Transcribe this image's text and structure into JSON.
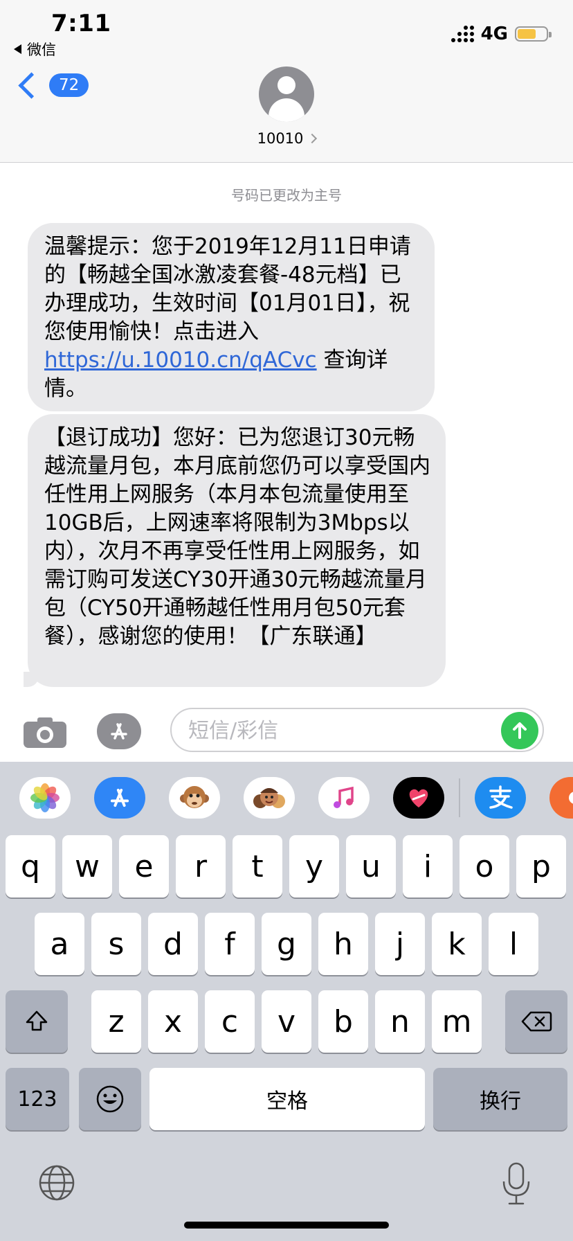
{
  "status_bar": {
    "time": "7:11",
    "back_app": "微信",
    "network": "4G",
    "battery_color": "#f6c344",
    "battery_level": 0.6
  },
  "header": {
    "unread_count": "72",
    "contact_name": "10010"
  },
  "conversation": {
    "system_note": "号码已更改为主号",
    "messages": [
      {
        "text_before_link": "温馨提示：您于2019年12月11日申请的【畅越全国冰激凌套餐-48元档】已办理成功，生效时间【01月01日】，祝您使用愉快！点击进入",
        "link": "https://u.10010.cn/qACvc",
        "text_after_link": " 查询详情。"
      },
      {
        "text": "【退订成功】您好：已为您退订30元畅越流量月包，本月底前您仍可以享受国内任性用上网服务（本月本包流量使用至10GB后，上网速率将限制为3Mbps以内），次月不再享受任性用上网服务，如需订购可发送CY30开通30元畅越流量月包（CY50开通畅越任性用月包50元套餐），感谢您的使用！【广东联通】"
      }
    ]
  },
  "input": {
    "placeholder": "短信/彩信",
    "value": ""
  },
  "app_strip": {
    "icons": [
      "photos-icon",
      "app-store-icon",
      "animoji-icon",
      "memoji-icon",
      "music-icon",
      "digital-touch-icon",
      "alipay-icon",
      "partial-app-icon"
    ]
  },
  "keyboard": {
    "row1": [
      "q",
      "w",
      "e",
      "r",
      "t",
      "y",
      "u",
      "i",
      "o",
      "p"
    ],
    "row2": [
      "a",
      "s",
      "d",
      "f",
      "g",
      "h",
      "j",
      "k",
      "l"
    ],
    "row3": [
      "z",
      "x",
      "c",
      "v",
      "b",
      "n",
      "m"
    ],
    "numbers_key": "123",
    "space_key": "空格",
    "return_key": "换行"
  },
  "colors": {
    "accent": "#2f7cf6",
    "link": "#2f67d7",
    "send": "#34c759",
    "bubble": "#e9e9eb",
    "keyboard_bg": "#d1d4db"
  }
}
